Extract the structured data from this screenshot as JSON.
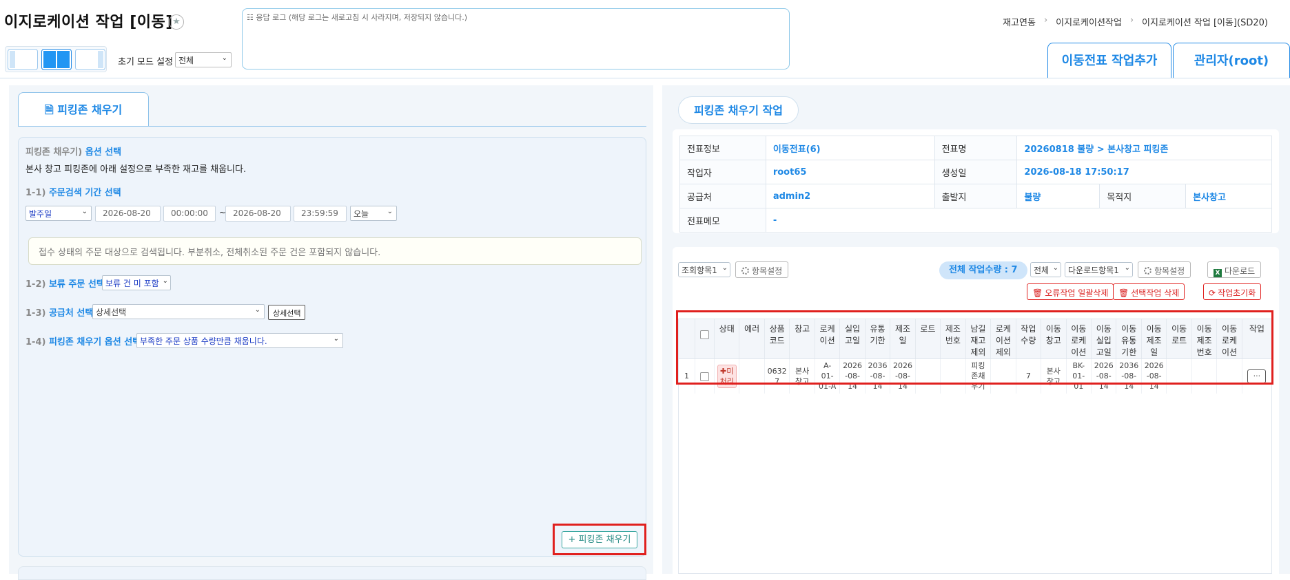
{
  "header": {
    "title": "이지로케이션 작업 [이동]",
    "init_mode_label": "초기 모드 설정",
    "init_mode_value": "전체",
    "log_text": "☷ 응답 로그 (해당 로그는 새로고침 시 사라지며, 저장되지 않습니다.)",
    "breadcrumb": [
      "재고연동",
      "이지로케이션작업",
      "이지로케이션 작업 [이동](SD20)"
    ],
    "tab_add": "이동전표 작업추가",
    "tab_admin": "관리자(root)"
  },
  "left": {
    "tab_label": "피킹존 채우기",
    "option_head_prefix": "피킹존 채우기)",
    "option_head_main": "옵션 선택",
    "option_desc": "본사 창고 피킹존에 아래 설정으로 부족한 재고를 채웁니다.",
    "sec1_prefix": "1-1)",
    "sec1_label": "주문검색 기간 선택",
    "date_type": "발주일",
    "date_from": "2026-08-20",
    "time_from": "00:00:00",
    "date_to": "2026-08-20",
    "time_to": "23:59:59",
    "quick_range": "오늘",
    "notice": "접수 상태의 주문 대상으로 검색됩니다. 부분취소, 전체취소된 주문 건은 포함되지 않습니다.",
    "sec2_prefix": "1-2)",
    "sec2_label": "보류 주문 선택",
    "sec2_value": "보류 건 미 포함",
    "sec3_prefix": "1-3)",
    "sec3_label": "공급처 선택",
    "sec3_value": "상세선택",
    "sec3_button": "상세선택",
    "sec4_prefix": "1-4)",
    "sec4_label": "피킹존 채우기 옵션 선택",
    "sec4_value": "부족한 주문 상품 수량만큼 채웁니다.",
    "fill_button": "+ 피킹존 채우기"
  },
  "right": {
    "tab_label": "피킹존 채우기 작업",
    "info": {
      "slip_info_label": "전표정보",
      "slip_info_value": "이동전표(6)",
      "slip_name_label": "전표명",
      "slip_name_value": "20260818 불량 > 본사창고 피킹존",
      "worker_label": "작업자",
      "worker_value": "root65",
      "created_label": "생성일",
      "created_value": "2026-08-18 17:50:17",
      "supplier_label": "공급처",
      "supplier_value": "admin2",
      "origin_label": "출발지",
      "origin_value": "불량",
      "dest_label": "목적지",
      "dest_value": "본사창고",
      "memo_label": "전표메모",
      "memo_value": "-"
    },
    "toolbar": {
      "view_select": "조회항목1",
      "item_setting": "항목설정",
      "total_qty": "전체 작업수량 : 7",
      "filter_select": "전체",
      "download_select": "다운로드항목1",
      "item_setting2": "항목설정",
      "download": "다운로드",
      "delete_errors": "오류작업 일괄삭제",
      "delete_selected": "선택작업 삭제",
      "reset_work": "작업초기화"
    },
    "grid": {
      "columns": [
        "",
        "",
        "상태",
        "에러",
        "상품\n코드",
        "창고",
        "로케\n이션",
        "실입\n고일",
        "유통\n기한",
        "제조\n일",
        "로트",
        "제조\n번호",
        "남길\n재고\n제외",
        "로케\n이션\n제외",
        "작업\n수량",
        "이동\n창고",
        "이동\n로케\n이션",
        "이동\n실입\n고일",
        "이동\n유통\n기한",
        "이동\n제조\n일",
        "이동\n로트",
        "이동\n제조\n번호",
        "이동\n로케\n이션",
        "작업"
      ],
      "row": {
        "no": "1",
        "status": "✚미\n처리",
        "error": "",
        "product_code": "0632\n7",
        "warehouse": "본사\n창고",
        "location": "A-\n01-\n01-A",
        "inbound": "2026\n-08-\n14",
        "expiry": "2036\n-08-\n14",
        "mfg": "2026\n-08-\n14",
        "lot": "",
        "mfg_no": "",
        "keep_stock": "피킹\n존채\n우기",
        "loc_excl": "",
        "qty": "7",
        "to_warehouse": "본사\n창고",
        "to_location": "BK-\n01-\n01",
        "to_inbound": "2026\n-08-\n14",
        "to_expiry": "2036\n-08-\n14",
        "to_mfg": "2026\n-08-\n14",
        "to_lot": "",
        "to_mfg_no": "",
        "to_loc2": "",
        "action": "···"
      }
    }
  }
}
